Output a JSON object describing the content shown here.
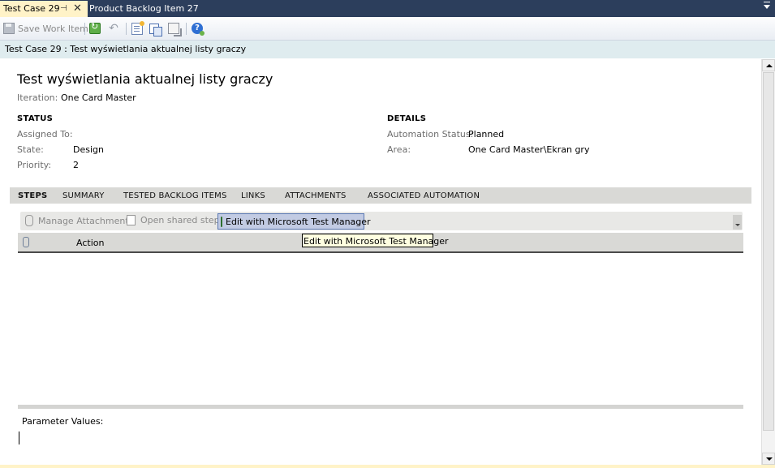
{
  "tabs": {
    "active_label": "Test Case 29",
    "inactive_label": "Product Backlog Item 27",
    "pin_glyph": "⊣",
    "close_glyph": "✕"
  },
  "toolbar": {
    "save_label": "Save Work Item",
    "icons": [
      "save-icon",
      "refresh-icon",
      "undo-icon",
      "new-linked-item-icon",
      "copy-icon",
      "branch-icon",
      "help-icon"
    ]
  },
  "header": {
    "caption": "Test Case 29 : Test wyświetlania aktualnej listy graczy"
  },
  "form": {
    "title": "Test wyświetlania aktualnej listy graczy",
    "iteration_label": "Iteration:",
    "iteration_value": "One Card Master",
    "status": {
      "heading": "STATUS",
      "assigned_label": "Assigned To:",
      "assigned_value": "",
      "state_label": "State:",
      "state_value": "Design",
      "priority_label": "Priority:",
      "priority_value": "2"
    },
    "details": {
      "heading": "DETAILS",
      "automation_label": "Automation Status:",
      "automation_value": "Planned",
      "area_label": "Area:",
      "area_value": "One Card Master\\Ekran gry"
    }
  },
  "section_tabs": [
    "STEPS",
    "SUMMARY",
    "TESTED BACKLOG ITEMS",
    "LINKS",
    "ATTACHMENTS",
    "ASSOCIATED AUTOMATION"
  ],
  "steps": {
    "manage_attachments": "Manage Attachments",
    "open_shared_steps": "Open shared steps",
    "edit_mtm": "Edit with Microsoft Test Manager",
    "column_action": "Action",
    "tooltip": "Edit with Microsoft Test Manager",
    "parameter_values_label": "Parameter Values:"
  },
  "colors": {
    "tabstrip_bg": "#2c3e5c",
    "active_tab_bg": "#fff3c8",
    "header_band_bg": "#dfecef",
    "section_tab_bg": "#d9d9d6",
    "highlight_button_bg": "#c2cbe3"
  }
}
